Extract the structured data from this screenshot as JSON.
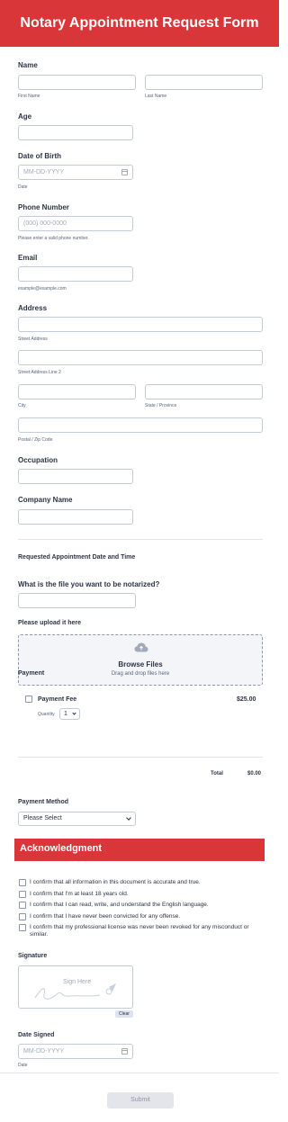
{
  "header": {
    "title": "Notary Appointment Request Form"
  },
  "name": {
    "label": "Name",
    "first_sub": "First Name",
    "last_sub": "Last Name"
  },
  "age": {
    "label": "Age"
  },
  "dob": {
    "label": "Date of Birth",
    "placeholder": "MM-DD-YYYY",
    "sub": "Date"
  },
  "phone": {
    "label": "Phone Number",
    "placeholder": "(000) 000-0000",
    "sub": "Please enter a valid phone number."
  },
  "email": {
    "label": "Email",
    "sub": "example@example.com"
  },
  "address": {
    "label": "Address",
    "street_sub": "Street Address",
    "street2_sub": "Street Address Line 2",
    "city_sub": "City",
    "state_sub": "State / Province",
    "zip_sub": "Postal / Zip Code"
  },
  "occupation": {
    "label": "Occupation"
  },
  "company": {
    "label": "Company Name"
  },
  "appointment": {
    "heading": "Requested Appointment Date and Time"
  },
  "file_question": {
    "label": "What is the file you want to be notarized?"
  },
  "upload": {
    "label": "Please upload it here",
    "browse": "Browse Files",
    "drag": "Drag and drop files here"
  },
  "payment": {
    "label": "Payment",
    "item_name": "Payment Fee",
    "item_price": "$25.00",
    "quantity_label": "Quantity",
    "quantity_value": "1",
    "total_label": "Total",
    "total_value": "$0.00"
  },
  "payment_method": {
    "label": "Payment Method",
    "value": "Please Select"
  },
  "acknowledgment": {
    "title": "Acknowledgment",
    "items": [
      "I confirm that all information in this document is accurate and true.",
      "I confirm that I'm at least 18 years old.",
      "I confirm that I can read, write, and understand the English language.",
      "I confirm that I have never been convicted for any offense.",
      "I confirm that my professional license was never been revoked for any misconduct or similar."
    ]
  },
  "signature": {
    "label": "Signature",
    "hint": "Sign Here",
    "clear": "Clear"
  },
  "date_signed": {
    "label": "Date Signed",
    "placeholder": "MM-DD-YYYY",
    "sub": "Date"
  },
  "submit": {
    "label": "Submit"
  },
  "colors": {
    "accent": "#d9363a",
    "border": "#c3cad8",
    "text": "#2c3345",
    "muted": "#57647e"
  }
}
